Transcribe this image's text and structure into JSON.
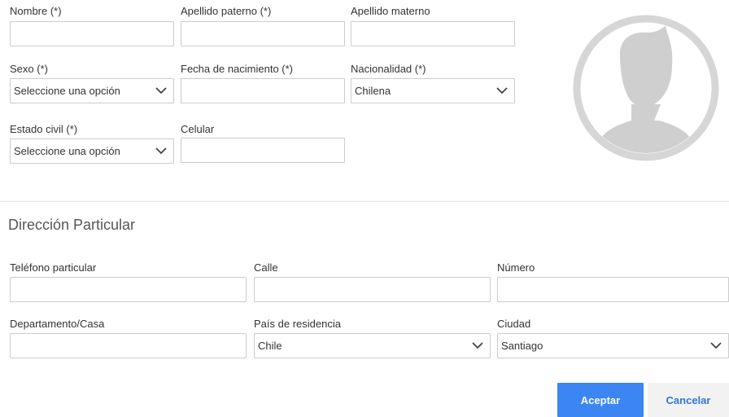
{
  "personal": {
    "nombre": {
      "label": "Nombre (*)",
      "value": ""
    },
    "apellido_paterno": {
      "label": "Apellido paterno (*)",
      "value": ""
    },
    "apellido_materno": {
      "label": "Apellido materno",
      "value": ""
    },
    "sexo": {
      "label": "Sexo (*)",
      "selected": "Seleccione una opción"
    },
    "fecha_nacimiento": {
      "label": "Fecha de nacimiento (*)",
      "value": ""
    },
    "nacionalidad": {
      "label": "Nacionalidad (*)",
      "selected": "Chilena"
    },
    "estado_civil": {
      "label": "Estado civil (*)",
      "selected": "Seleccione una opción"
    },
    "celular": {
      "label": "Celular",
      "value": ""
    }
  },
  "address": {
    "section_title": "Dirección Particular",
    "telefono": {
      "label": "Teléfono particular",
      "value": ""
    },
    "calle": {
      "label": "Calle",
      "value": ""
    },
    "numero": {
      "label": "Número",
      "value": ""
    },
    "departamento": {
      "label": "Departamento/Casa",
      "value": ""
    },
    "pais": {
      "label": "País de residencia",
      "selected": "Chile"
    },
    "ciudad": {
      "label": "Ciudad",
      "selected": "Santiago"
    }
  },
  "actions": {
    "accept_label": "Aceptar",
    "cancel_label": "Cancelar"
  },
  "icons": {
    "avatar": "user-avatar-placeholder-icon",
    "dropdown": "chevron-down-icon"
  },
  "colors": {
    "primary_button": "#3b86f2",
    "secondary_button_bg": "#f2f2f2",
    "secondary_button_text": "#2f77d6",
    "input_border": "#cccccc",
    "avatar_gray": "#cfcfcf"
  }
}
